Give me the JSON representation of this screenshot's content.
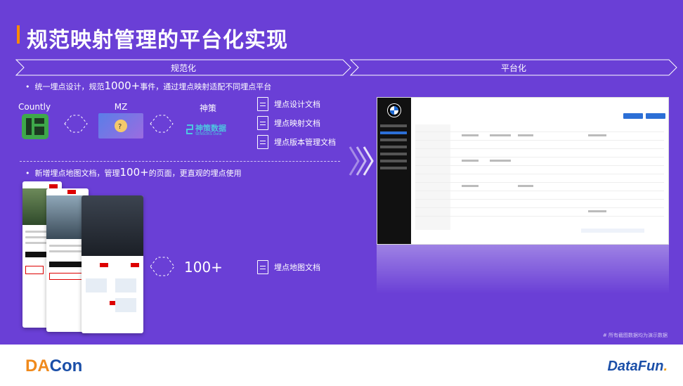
{
  "title": "规范映射管理的平台化实现",
  "sections": {
    "left_label": "规范化",
    "right_label": "平台化"
  },
  "bullets": {
    "first_pre": "统一埋点设计，规范",
    "first_num": "1000+",
    "first_post": "事件，通过埋点映射适配不同埋点平台",
    "second_pre": "新增埋点地图文档，管理",
    "second_num": "100+",
    "second_post": "的页面，更直观的埋点使用"
  },
  "platforms": {
    "countly": "Countly",
    "mz": "MZ",
    "shence": "神策",
    "shence_logo_text": "神策数据",
    "shence_logo_sub": "SENSORS Data"
  },
  "docs": {
    "design": "埋点设计文档",
    "mapping": "埋点映射文档",
    "version": "埋点版本管理文档",
    "map": "埋点地图文档"
  },
  "page_count": "100+",
  "footnote": "# 所有截图数据均为演示数据",
  "footer": {
    "left_logo_da": "DA",
    "left_logo_con": "Con",
    "right_logo_main": "DataFun",
    "right_logo_dot": "."
  },
  "colors": {
    "background": "#6a3fd6",
    "accent": "#ff8a00",
    "dacon_orange": "#f08a1c",
    "dacon_blue": "#1b4fa8"
  }
}
